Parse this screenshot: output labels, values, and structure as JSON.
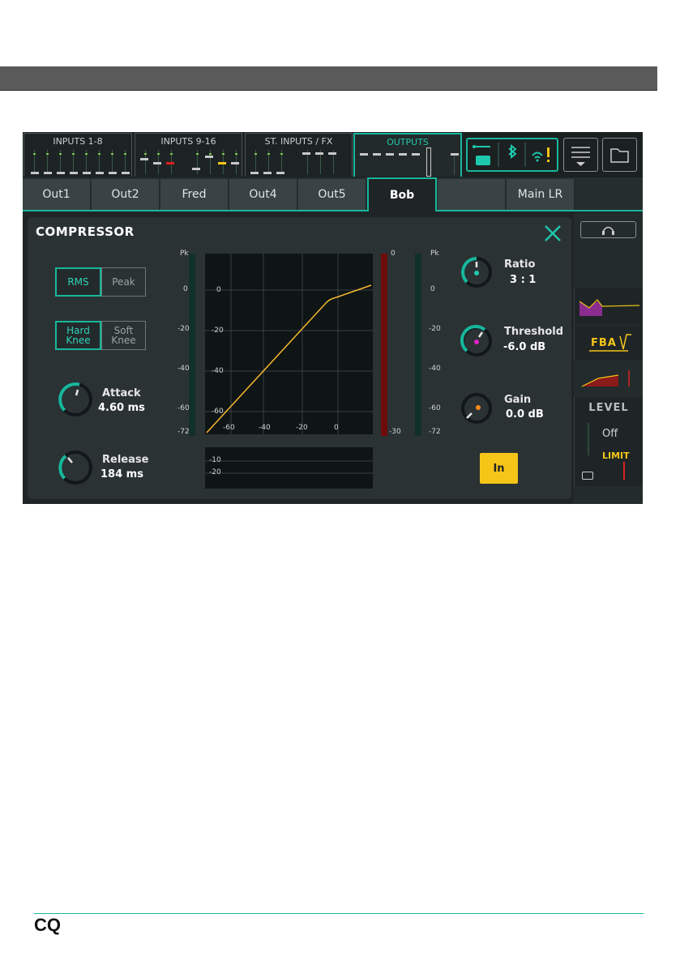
{
  "nav": {
    "tabs": [
      "INPUTS 1-8",
      "INPUTS 9-16",
      "ST. INPUTS / FX",
      "OUTPUTS"
    ],
    "active_tab": "OUTPUTS"
  },
  "channels": {
    "tabs": [
      "Out1",
      "Out2",
      "Fred",
      "Out4",
      "Out5",
      "Bob",
      "",
      "Main LR"
    ],
    "selected": "Bob"
  },
  "compressor": {
    "title": "COMPRESSOR",
    "detector": {
      "rms": "RMS",
      "peak": "Peak",
      "selected": "RMS"
    },
    "knee": {
      "hard": "Hard Knee",
      "soft": "Soft Knee",
      "selected": "Hard Knee"
    },
    "attack": {
      "label": "Attack",
      "value": "4.60 ms"
    },
    "release": {
      "label": "Release",
      "value": "184 ms"
    },
    "ratio": {
      "label": "Ratio",
      "value": "3 : 1"
    },
    "threshold": {
      "label": "Threshold",
      "value": "-6.0 dB"
    },
    "gain": {
      "label": "Gain",
      "value": "0.0 dB"
    },
    "in_button": "In",
    "input_meter_scale": [
      "Pk",
      "0",
      "-20",
      "-40",
      "-60",
      "-72"
    ],
    "output_meter_scale": [
      "Pk",
      "0",
      "-20",
      "-40",
      "-60",
      "-72"
    ],
    "gr_meter_scale": [
      "0",
      "-30"
    ],
    "graph_y_ticks": [
      "0",
      "-20",
      "-40",
      "-60"
    ],
    "graph_x_ticks": [
      "-60",
      "-40",
      "-20",
      "0"
    ],
    "history_ticks": [
      "-10",
      "-20"
    ]
  },
  "right_strip": {
    "fba_label": "FBA",
    "level_label": "LEVEL",
    "level_value": "Off",
    "limit_label": "LIMIT"
  },
  "footer": {
    "logo": "CQ"
  },
  "colors": {
    "accent": "#17b79c",
    "in_button": "#f5c518",
    "curve": "#f5b72e",
    "threshold_dot": "#e020c8",
    "gain_dot": "#ff8a1e"
  }
}
